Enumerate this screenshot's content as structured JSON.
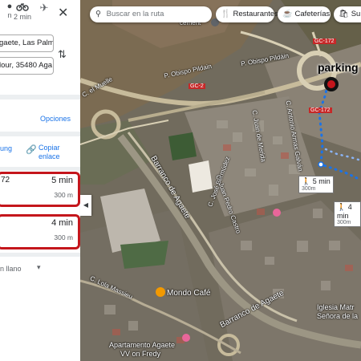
{
  "sidebar": {
    "modes": [
      {
        "icon": "car-icon",
        "label": "n"
      },
      {
        "icon": "bicycle-icon",
        "label": "2 min"
      },
      {
        "icon": "airplane-icon",
        "label": ""
      }
    ],
    "origin_value": "gaete, Las Palm",
    "destination_value": "lour, 35480 Aga",
    "options_label": "Opciones",
    "share_partial": "ung",
    "copy_link_label_1": "Copiar",
    "copy_link_label_2": "enlace",
    "routes": [
      {
        "number": "72",
        "duration": "5 min",
        "distance": "300 m"
      },
      {
        "number": "",
        "duration": "4 min",
        "distance": "300 m"
      }
    ],
    "terrain_label": "n llano"
  },
  "map": {
    "search_placeholder": "Buscar en la ruta",
    "chips": [
      {
        "icon": "restaurant-icon",
        "label": "Restaurantes"
      },
      {
        "icon": "coffee-icon",
        "label": "Cafeterías"
      },
      {
        "icon": "shopping-bag-icon",
        "label": "Supe"
      }
    ],
    "labels": {
      "parking": "parking",
      "road_gc2": "GC-2",
      "road_gc172": "GC-172",
      "road_gc172b": "GC-172",
      "street_obispo_1": "P. Obispo Pildain",
      "street_obispo_2": "P. Obispo Pildáin",
      "street_muelle": "C. el Muelle",
      "barranco_1": "Barranco de Agaete",
      "barranco_2": "Barranco de Agaete",
      "jose_bermudez": "C. José Bermúdez",
      "juan_pedro": "C. Juan Pedro Castro",
      "juan_de_merida": "C. Juan de Merida",
      "antonio_armas": "C. Antonio Armas Galván",
      "lola_massieu": "C. Lola Massieu",
      "mondo_cafe": "Mondo Café",
      "apartamento_1": "Apartamento Agaete",
      "apartamento_2": "VV on Fredy",
      "iglesia_1": "Iglesia Matr",
      "iglesia_2": "Señora de la",
      "cemetery": "cement"
    },
    "walk_boxes": [
      {
        "duration": "5 min",
        "distance": "300m"
      },
      {
        "duration": "4 min",
        "distance": "300m"
      }
    ],
    "colors": {
      "route_blue": "#1a73e8",
      "route_alt": "#8ab4f8",
      "highlight_red": "#c4161c",
      "link_blue": "#1a73e8"
    }
  }
}
